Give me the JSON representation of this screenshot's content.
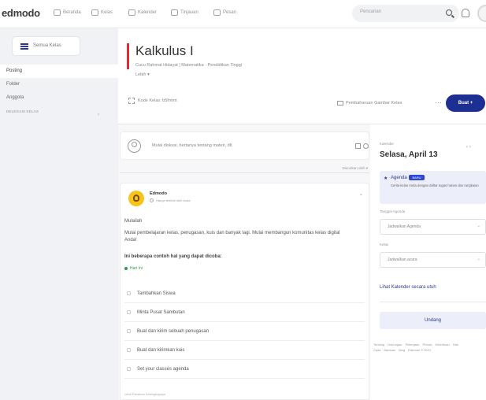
{
  "topbar": {
    "logo": "edmodo",
    "nav": [
      {
        "label": "Beranda",
        "icon": "home-icon"
      },
      {
        "label": "Kelas",
        "icon": "class-icon"
      },
      {
        "label": "Kalender",
        "icon": "calendar-icon"
      },
      {
        "label": "Tinjauan",
        "icon": "review-icon"
      },
      {
        "label": "Pesan",
        "icon": "message-icon"
      }
    ],
    "search_placeholder": "Pencarian"
  },
  "sidebar": {
    "button_label": "Semua Kelas",
    "items": [
      {
        "label": "Posting"
      },
      {
        "label": "Folder"
      },
      {
        "label": "Anggota"
      },
      {
        "label": "DELEGASI KELAS"
      }
    ]
  },
  "header": {
    "title": "Kalkulus I",
    "subtitle": "Cucu Rahmat Hidayat | Matematika · Pendidikan Tinggi",
    "more": "Lebih ▾",
    "code_button": "Kode Kelas: b5fmmt",
    "bg_button": "Pembaharuan Gambar Kelas",
    "create_button": "Buat +"
  },
  "composer": {
    "text": "Mulai diskusi, bertanya tentang materi, dll."
  },
  "sort_label": "Diurutkan oleh ▾",
  "post": {
    "author": "Edmodo",
    "meta": "Hanya terlihat oleh Anda",
    "greeting": "Mulailah",
    "body": "Mulai pembelajaran kelas, penugasan, kuis dan banyak lagi. Mulai membangun komunitas kelas digital Anda!",
    "bold_line": "Ini beberapa contoh hal yang dapat dicoba:",
    "badge": "Hari Ini",
    "tasks": [
      "Tambahkan Siswa",
      "Minta Pusat Sambutan",
      "Buat dan kirim sebuah penugasan",
      "Buat dan kirimkan kuis",
      "Set your classes agenda"
    ],
    "footer": "Lihat Panduan Selengkapnya"
  },
  "calendar": {
    "label": "Kalender",
    "date": "Selasa, April 13",
    "agenda_title": "Agenda",
    "agenda_pill": "BARU",
    "agenda_desc": "Cerita kelas Anda dengan daftar tugas harian dan rangkaian",
    "type_label": "Tanggal Agenda",
    "type_placeholder": "Jadwalkan Agenda",
    "class_label": "Kelas",
    "class_placeholder": "Jadwalkan acara",
    "link": "Lihat Kalender secara utuh",
    "button": "Undang",
    "footer": [
      "Tentang",
      "Dukungan",
      "Pekerjaan",
      "Privasi",
      "Ketentuan",
      "Hak Cipta",
      "Bantuan",
      "Blog",
      "Edmodo © 2021"
    ]
  }
}
